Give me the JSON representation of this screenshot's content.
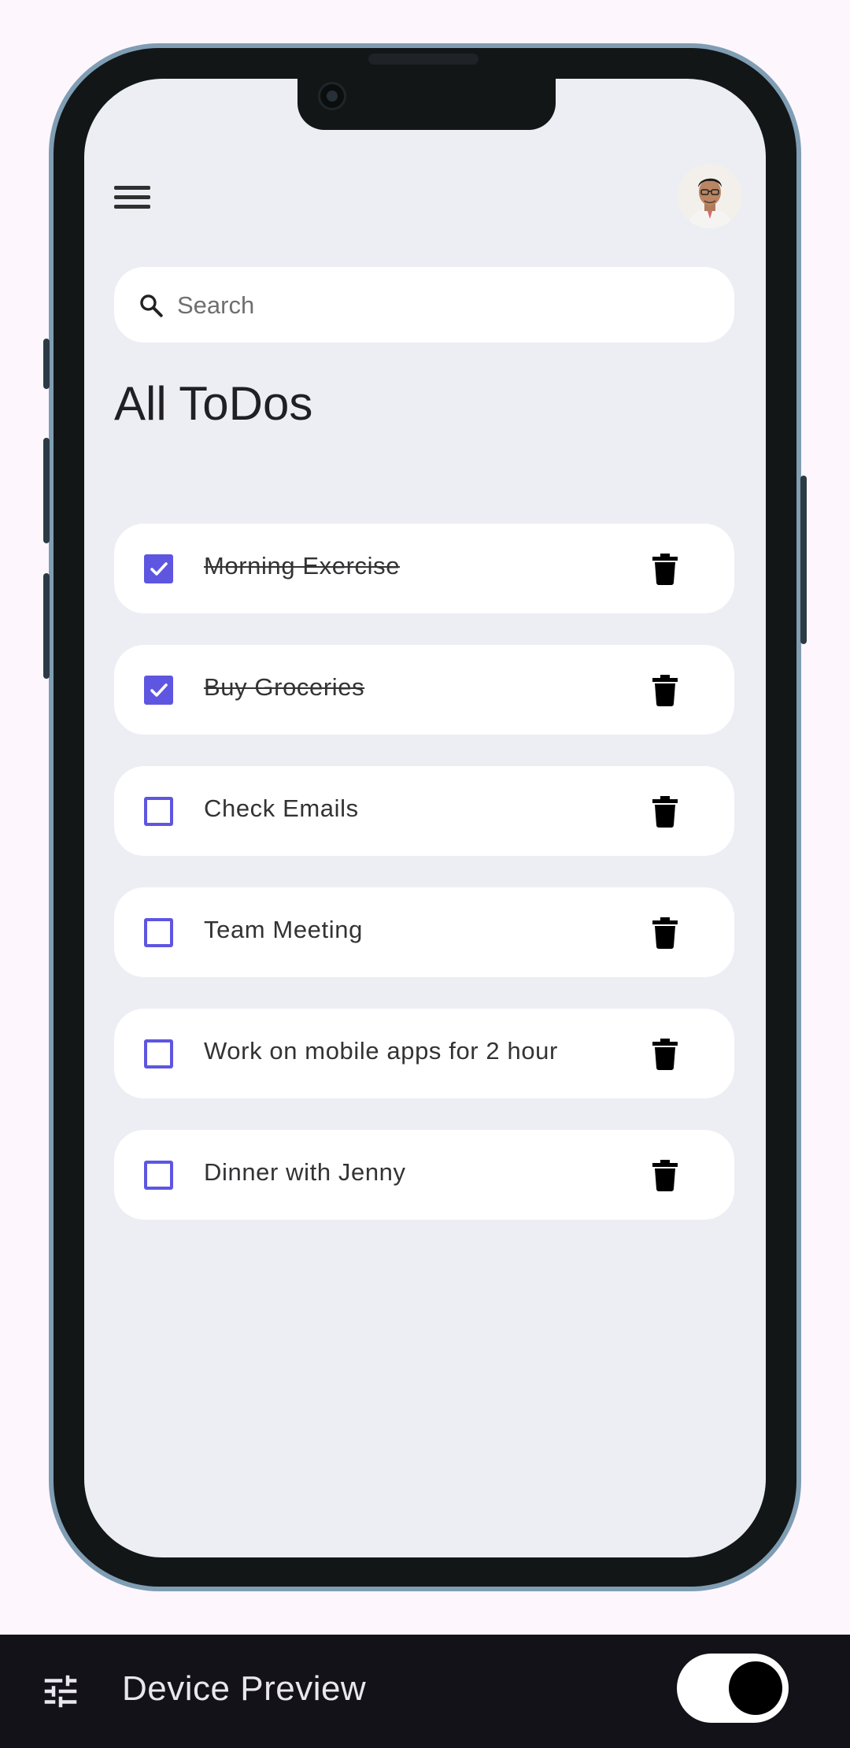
{
  "app": {
    "title": "All ToDos",
    "search": {
      "placeholder": "Search",
      "value": ""
    },
    "accent_color": "#5e56e0",
    "todos": [
      {
        "text": "Morning Exercise",
        "done": true
      },
      {
        "text": "Buy Groceries",
        "done": true
      },
      {
        "text": "Check Emails",
        "done": false
      },
      {
        "text": "Team Meeting",
        "done": false
      },
      {
        "text": "Work on mobile apps for 2 hour",
        "done": false
      },
      {
        "text": "Dinner with Jenny",
        "done": false
      }
    ]
  },
  "device_preview": {
    "label": "Device Preview",
    "enabled": true
  },
  "icons": {
    "menu": "menu-icon",
    "search": "search-icon",
    "delete": "delete-icon",
    "checkbox": "checkbox-icon",
    "tune": "tune-icon"
  }
}
